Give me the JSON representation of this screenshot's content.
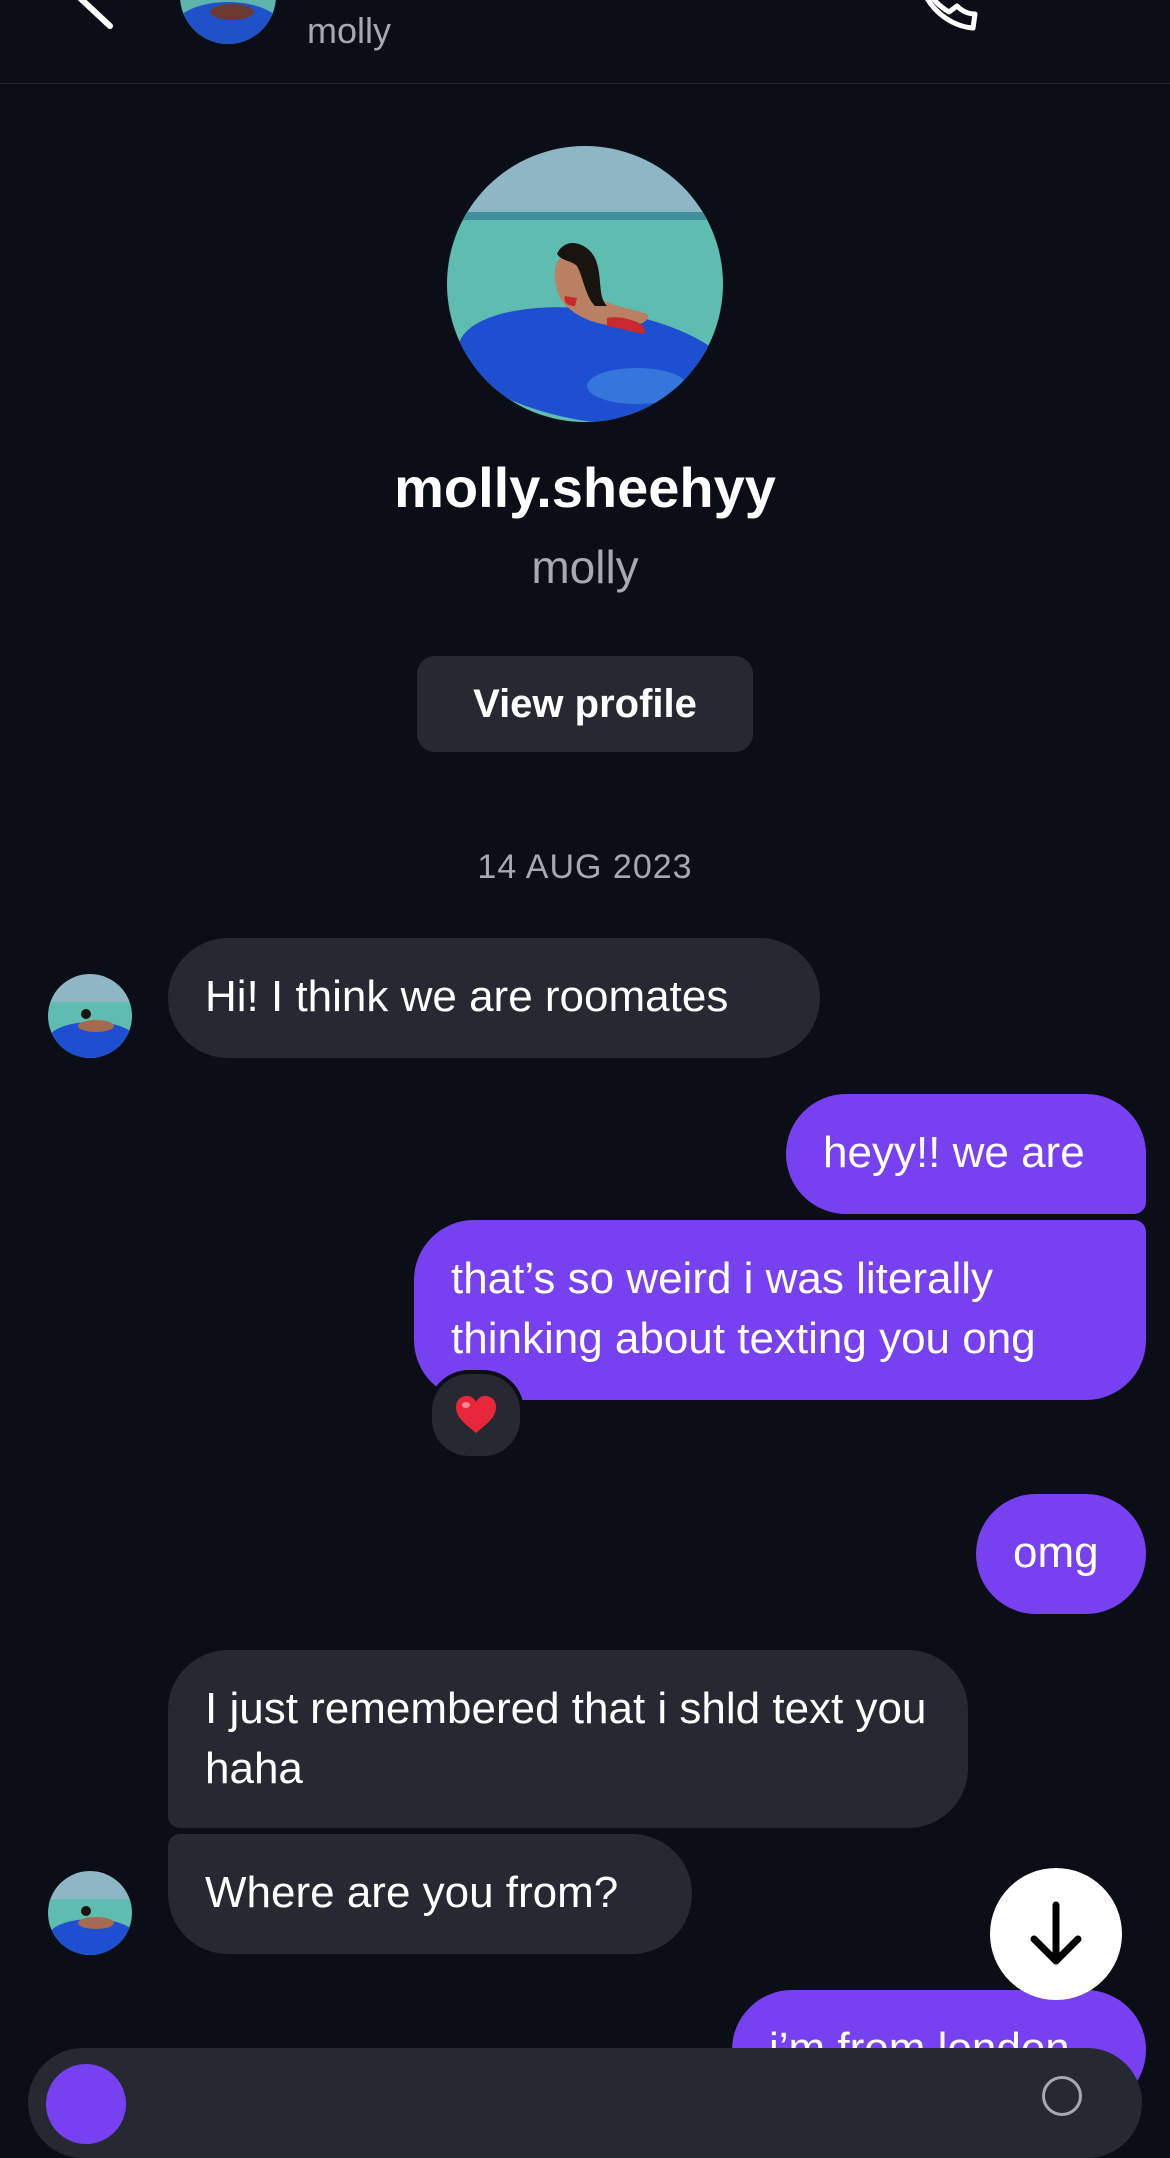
{
  "header": {
    "subname": "molly",
    "back_icon": "chevron-left-icon",
    "call_icon": "phone-icon",
    "video_icon": "video-camera-icon"
  },
  "profile": {
    "username": "molly.sheehyy",
    "name": "molly",
    "view_profile_label": "View profile"
  },
  "conversation": {
    "date_divider": "14 AUG 2023",
    "messages": [
      {
        "direction": "incoming",
        "text": "Hi! I think we are roomates"
      },
      {
        "direction": "outgoing",
        "text": "heyy!! we are"
      },
      {
        "direction": "outgoing",
        "text": "that’s so weird i was literally thinking about texting you ong",
        "reaction": "❤️"
      },
      {
        "direction": "outgoing",
        "text": "omg"
      },
      {
        "direction": "incoming",
        "text": "I just remembered that i shld text you haha"
      },
      {
        "direction": "incoming",
        "text": "Where are you from?"
      },
      {
        "direction": "outgoing",
        "text": "i’m from london"
      }
    ]
  },
  "controls": {
    "scroll_down_icon": "arrow-down-icon"
  },
  "colors": {
    "background": "#0b0e16",
    "incoming_bubble": "#262931",
    "outgoing_bubble": "#7740f0",
    "secondary_text": "#a7a9b0"
  }
}
